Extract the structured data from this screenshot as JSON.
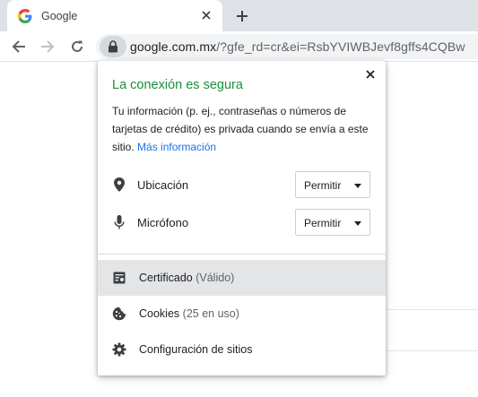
{
  "tab": {
    "title": "Google",
    "favicon": "google-g-icon"
  },
  "toolbar": {
    "url_host": "google.com.mx",
    "url_rest": "/?gfe_rd=cr&ei=RsbYVIWBJevf8gffs4CQBw"
  },
  "popup": {
    "title": "La conexión es segura",
    "description": "Tu información (p. ej., contraseñas o números de tarjetas de crédito) es privada cuando se envía a este sitio.",
    "link": "Más información",
    "permissions": [
      {
        "label": "Ubicación",
        "icon": "location-pin-icon",
        "value": "Permitir"
      },
      {
        "label": "Micrófono",
        "icon": "microphone-icon",
        "value": "Permitir"
      }
    ],
    "menu": [
      {
        "label": "Certificado",
        "sub": "(Válido)",
        "icon": "certificate-icon"
      },
      {
        "label": "Cookies",
        "sub": "(25 en uso)",
        "icon": "cookie-icon"
      },
      {
        "label": "Configuración de sitios",
        "sub": "",
        "icon": "gear-icon"
      }
    ]
  },
  "colors": {
    "secure_green": "#1e8e3e",
    "link_blue": "#1a73e8",
    "tabstrip": "#dee1e6"
  }
}
